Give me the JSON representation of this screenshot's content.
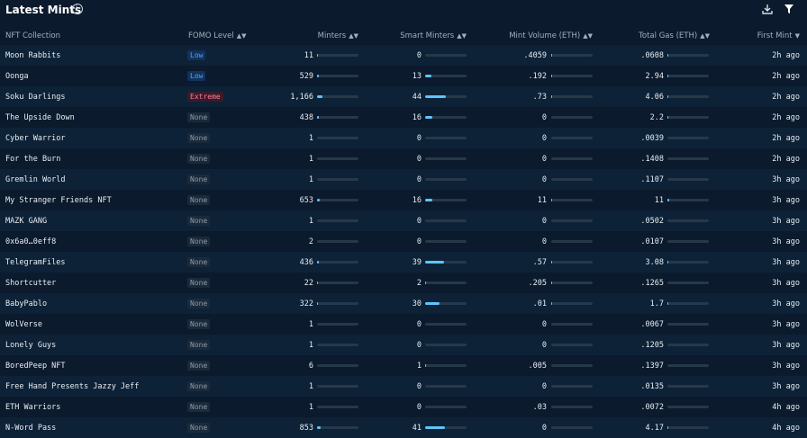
{
  "title": "Latest Mints",
  "icons": {
    "info": "info-icon",
    "download": "download-icon",
    "filter": "filter-icon"
  },
  "colors": {
    "background": "#0b1a2c",
    "bar_fill": "#5cc6ff",
    "badge_low": "#4ea6ff",
    "badge_extreme": "#ff7a9a"
  },
  "headers": {
    "collection": "NFT Collection",
    "fomo": "FOMO Level",
    "minters": "Minters",
    "smart_minters": "Smart Minters",
    "mint_volume": "Mint Volume (ETH)",
    "total_gas": "Total Gas (ETH)",
    "first_mint": "First Mint"
  },
  "rows": [
    {
      "name": "Moon Rabbits",
      "fomo": "Low",
      "minters": "11",
      "minters_fill": 0.02,
      "smart": "0",
      "smart_fill": 0,
      "volume": ".4059",
      "volume_fill": 0.01,
      "gas": ".0608",
      "gas_fill": 0.01,
      "first": "2h ago"
    },
    {
      "name": "Oonga",
      "fomo": "Low",
      "minters": "529",
      "minters_fill": 0.05,
      "smart": "13",
      "smart_fill": 0.15,
      "volume": ".192",
      "volume_fill": 0.01,
      "gas": "2.94",
      "gas_fill": 0.01,
      "first": "2h ago"
    },
    {
      "name": "Soku Darlings",
      "fomo": "Extreme",
      "minters": "1,166",
      "minters_fill": 0.12,
      "smart": "44",
      "smart_fill": 0.5,
      "volume": ".73",
      "volume_fill": 0.01,
      "gas": "4.06",
      "gas_fill": 0.02,
      "first": "2h ago"
    },
    {
      "name": "The Upside Down",
      "fomo": "None",
      "minters": "438",
      "minters_fill": 0.04,
      "smart": "16",
      "smart_fill": 0.18,
      "volume": "0",
      "volume_fill": 0,
      "gas": "2.2",
      "gas_fill": 0.01,
      "first": "2h ago"
    },
    {
      "name": "Cyber Warrior",
      "fomo": "None",
      "minters": "1",
      "minters_fill": 0,
      "smart": "0",
      "smart_fill": 0,
      "volume": "0",
      "volume_fill": 0,
      "gas": ".0039",
      "gas_fill": 0,
      "first": "2h ago"
    },
    {
      "name": "For the Burn",
      "fomo": "None",
      "minters": "1",
      "minters_fill": 0,
      "smart": "0",
      "smart_fill": 0,
      "volume": "0",
      "volume_fill": 0,
      "gas": ".1408",
      "gas_fill": 0,
      "first": "2h ago"
    },
    {
      "name": "Gremlin World",
      "fomo": "None",
      "minters": "1",
      "minters_fill": 0,
      "smart": "0",
      "smart_fill": 0,
      "volume": "0",
      "volume_fill": 0,
      "gas": ".1107",
      "gas_fill": 0,
      "first": "3h ago"
    },
    {
      "name": "My Stranger Friends NFT",
      "fomo": "None",
      "minters": "653",
      "minters_fill": 0.06,
      "smart": "16",
      "smart_fill": 0.18,
      "volume": "11",
      "volume_fill": 0.02,
      "gas": "11",
      "gas_fill": 0.04,
      "first": "3h ago"
    },
    {
      "name": "MAZK GANG",
      "fomo": "None",
      "minters": "1",
      "minters_fill": 0,
      "smart": "0",
      "smart_fill": 0,
      "volume": "0",
      "volume_fill": 0,
      "gas": ".0502",
      "gas_fill": 0,
      "first": "3h ago"
    },
    {
      "name": "0x6a0…0eff8",
      "fomo": "None",
      "minters": "2",
      "minters_fill": 0,
      "smart": "0",
      "smart_fill": 0,
      "volume": "0",
      "volume_fill": 0,
      "gas": ".0107",
      "gas_fill": 0,
      "first": "3h ago"
    },
    {
      "name": "TelegramFiles",
      "fomo": "None",
      "minters": "436",
      "minters_fill": 0.04,
      "smart": "39",
      "smart_fill": 0.45,
      "volume": ".57",
      "volume_fill": 0.01,
      "gas": "3.08",
      "gas_fill": 0.01,
      "first": "3h ago"
    },
    {
      "name": "Shortcutter",
      "fomo": "None",
      "minters": "22",
      "minters_fill": 0.01,
      "smart": "2",
      "smart_fill": 0.02,
      "volume": ".205",
      "volume_fill": 0.01,
      "gas": ".1265",
      "gas_fill": 0,
      "first": "3h ago"
    },
    {
      "name": "BabyPablo",
      "fomo": "None",
      "minters": "322",
      "minters_fill": 0.03,
      "smart": "30",
      "smart_fill": 0.35,
      "volume": ".01",
      "volume_fill": 0.01,
      "gas": "1.7",
      "gas_fill": 0.01,
      "first": "3h ago"
    },
    {
      "name": "WolVerse",
      "fomo": "None",
      "minters": "1",
      "minters_fill": 0,
      "smart": "0",
      "smart_fill": 0,
      "volume": "0",
      "volume_fill": 0,
      "gas": ".0067",
      "gas_fill": 0,
      "first": "3h ago"
    },
    {
      "name": "Lonely Guys",
      "fomo": "None",
      "minters": "1",
      "minters_fill": 0,
      "smart": "0",
      "smart_fill": 0,
      "volume": "0",
      "volume_fill": 0,
      "gas": ".1205",
      "gas_fill": 0,
      "first": "3h ago"
    },
    {
      "name": "BoredPeep NFT",
      "fomo": "None",
      "minters": "6",
      "minters_fill": 0,
      "smart": "1",
      "smart_fill": 0.01,
      "volume": ".005",
      "volume_fill": 0,
      "gas": ".1397",
      "gas_fill": 0,
      "first": "3h ago"
    },
    {
      "name": "Free Hand Presents Jazzy Jeff",
      "fomo": "None",
      "minters": "1",
      "minters_fill": 0,
      "smart": "0",
      "smart_fill": 0,
      "volume": "0",
      "volume_fill": 0,
      "gas": ".0135",
      "gas_fill": 0,
      "first": "3h ago"
    },
    {
      "name": "ETH Warriors",
      "fomo": "None",
      "minters": "1",
      "minters_fill": 0,
      "smart": "0",
      "smart_fill": 0,
      "volume": ".03",
      "volume_fill": 0,
      "gas": ".0072",
      "gas_fill": 0,
      "first": "4h ago"
    },
    {
      "name": "N-Word Pass",
      "fomo": "None",
      "minters": "853",
      "minters_fill": 0.08,
      "smart": "41",
      "smart_fill": 0.48,
      "volume": "0",
      "volume_fill": 0,
      "gas": "4.17",
      "gas_fill": 0.02,
      "first": "4h ago"
    }
  ]
}
